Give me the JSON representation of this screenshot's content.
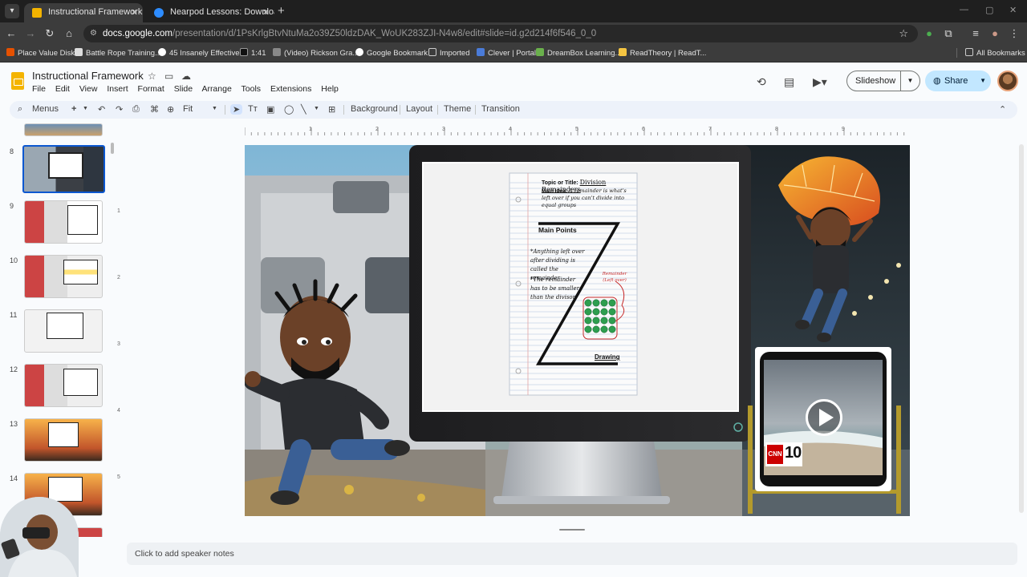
{
  "browser": {
    "tabs": [
      {
        "title": "Instructional Framework - Goo",
        "active": true,
        "favicon_color": "#f4b400"
      },
      {
        "title": "Nearpod Lessons: Download m",
        "active": false,
        "favicon_color": "#2d8cff"
      }
    ],
    "url_host": "docs.google.com",
    "url_path": "/presentation/d/1PsKrlgBtvNtuMa2o39Z50ldzDAK_WoUK283ZJI-N4w8/edit#slide=id.g2d214f6f546_0_0",
    "bookmarks": [
      "Place Value Disks",
      "Battle Rope Training...",
      "45 Insanely Effective...",
      "1:41",
      "(Video) Rickson Gra...",
      "Google Bookmark",
      "Imported",
      "Clever | Portal",
      "DreamBox Learning...",
      "ReadTheory | ReadT..."
    ],
    "all_bookmarks": "All Bookmarks"
  },
  "doc": {
    "title": "Instructional Framework",
    "menu": [
      "File",
      "Edit",
      "View",
      "Insert",
      "Format",
      "Slide",
      "Arrange",
      "Tools",
      "Extensions",
      "Help"
    ],
    "slideshow_label": "Slideshow",
    "share_label": "Share"
  },
  "toolbar": {
    "menus_label": "Menus",
    "zoom": "Fit",
    "background": "Background",
    "layout": "Layout",
    "theme": "Theme",
    "transition": "Transition"
  },
  "filmstrip": {
    "slide_numbers": [
      "8",
      "9",
      "10",
      "11",
      "12",
      "13",
      "14"
    ],
    "active": "8"
  },
  "ruler": {
    "h": [
      "1",
      "2",
      "3",
      "4",
      "5",
      "6",
      "7",
      "8",
      "9"
    ],
    "v": [
      "1",
      "2",
      "3",
      "4",
      "5"
    ]
  },
  "slide": {
    "notes_top": {
      "topic_label": "Topic or Title:",
      "topic": "Division Remainders",
      "main_idea_label": "Main Idea:",
      "main_idea": "A remainder is what's left over if you can't divide into equal groups"
    },
    "main_points_label": "Main Points",
    "points": [
      "*Anything left over after dividing is called the remainder",
      "*The remainder has to be smaller than the divisor"
    ],
    "remainder_note": "Remainder (Left over)",
    "drawing_label": "Drawing",
    "video_badge": "10",
    "video_brand": "CNN"
  },
  "speaker_notes_placeholder": "Click to add speaker notes"
}
